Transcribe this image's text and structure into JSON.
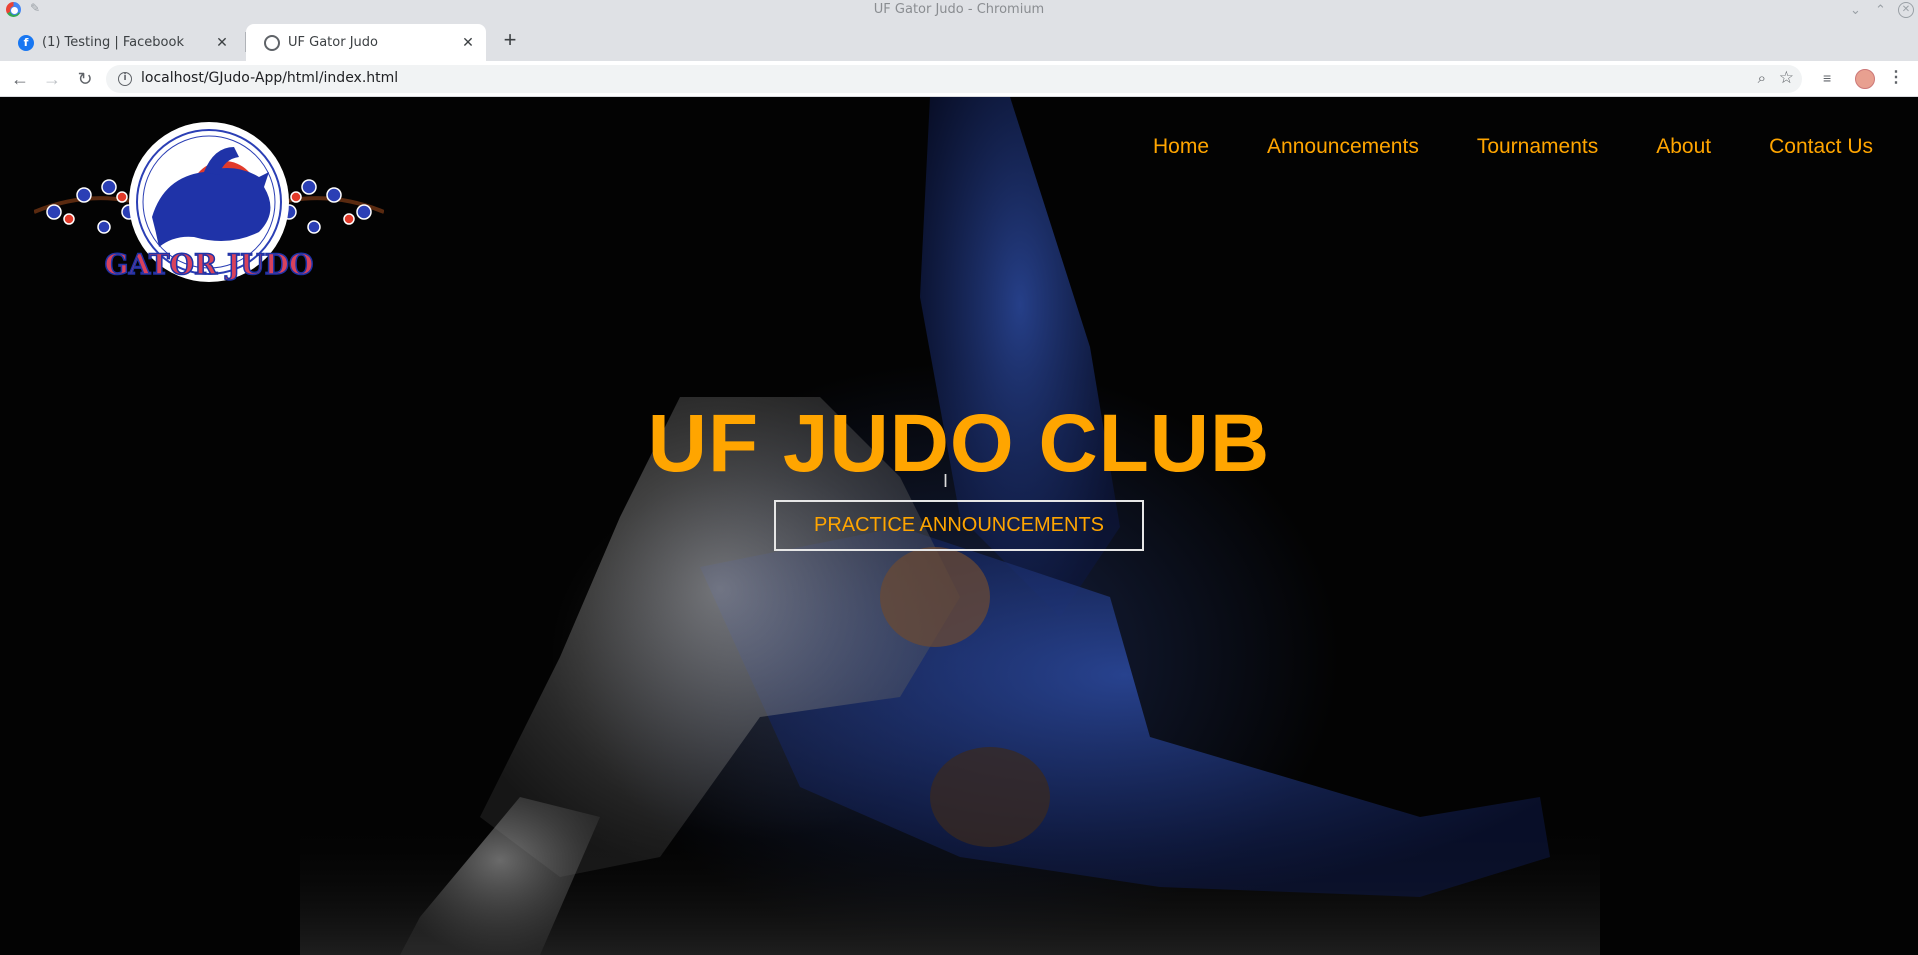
{
  "window": {
    "title": "UF Gator Judo - Chromium"
  },
  "tabs": [
    {
      "label": "(1) Testing | Facebook",
      "favicon": "facebook-icon"
    },
    {
      "label": "UF Gator Judo",
      "favicon": "globe-icon"
    }
  ],
  "address_bar": {
    "url": "localhost/GJudo-App/html/index.html"
  },
  "page": {
    "nav": {
      "items": [
        "Home",
        "Announcements",
        "Tournaments",
        "About",
        "Contact Us"
      ]
    },
    "hero": {
      "title": "UF JUDO CLUB",
      "button_label": "PRACTICE ANNOUNCEMENTS"
    },
    "logo": {
      "text": "GATOR JUDO"
    },
    "colors": {
      "accent": "#ffa500",
      "background": "#030303"
    }
  }
}
